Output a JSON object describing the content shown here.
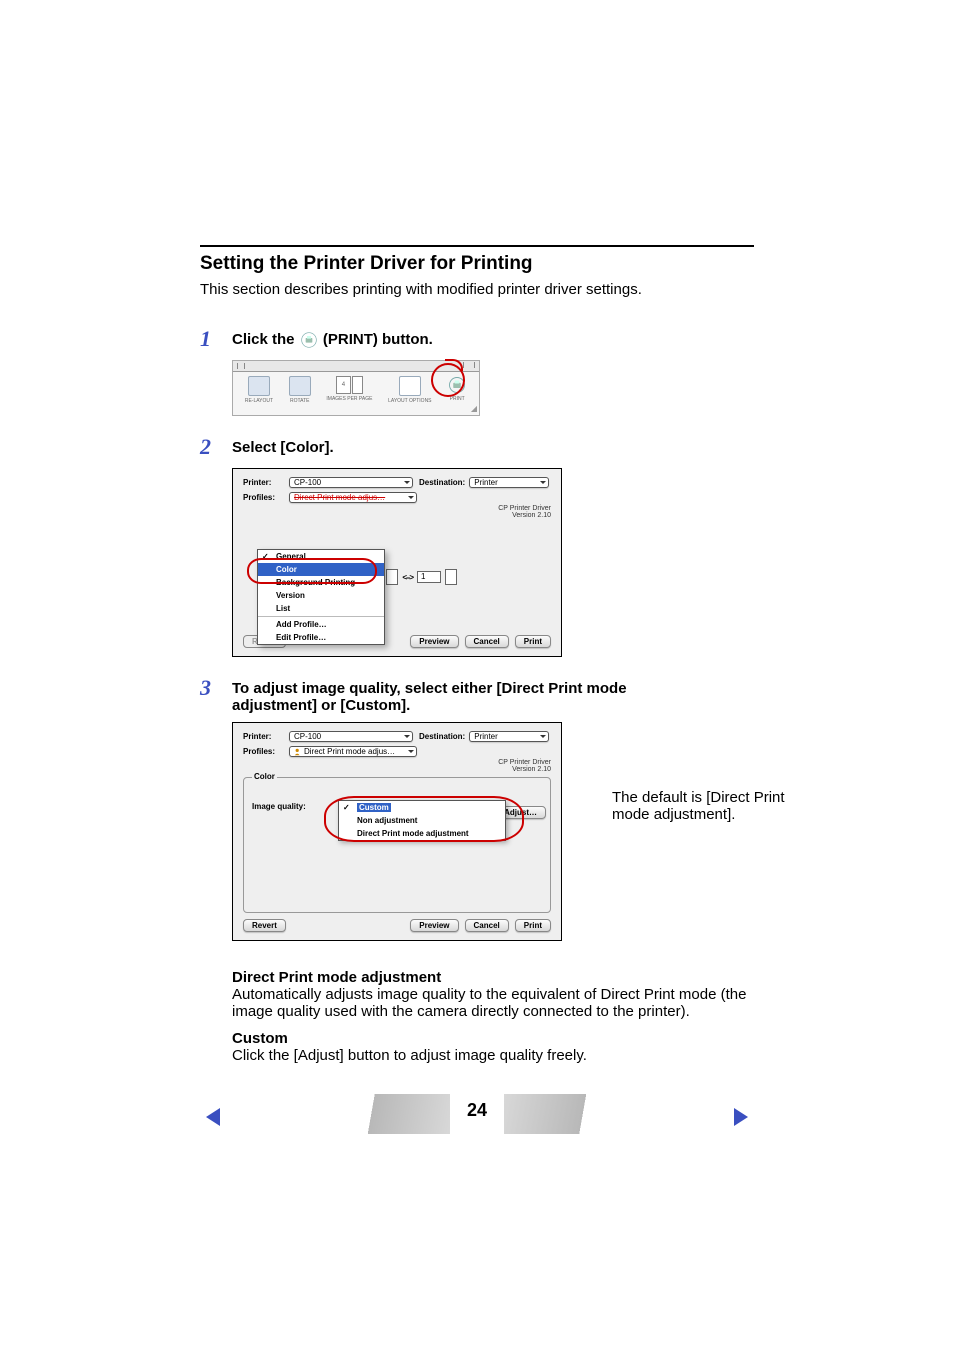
{
  "section": {
    "title": "Setting the Printer Driver for Printing",
    "desc": "This section describes printing with modified printer driver settings."
  },
  "step1": {
    "num": "1",
    "text_before": "Click the ",
    "text_after": " (PRINT) button.",
    "toolbar": {
      "relayout": "RE-LAYOUT",
      "rotate": "ROTATE",
      "images_per_page": "IMAGES PER PAGE",
      "images_value": "4",
      "layout_options": "LAYOUT OPTIONS",
      "print": "PRINT"
    }
  },
  "step2": {
    "num": "2",
    "text": "Select [Color].",
    "dialog": {
      "printer_label": "Printer:",
      "printer_value": "CP-100",
      "destination_label": "Destination:",
      "destination_value": "Printer",
      "profiles_label": "Profiles:",
      "profiles_value": "Direct Print mode adjus…",
      "driver_line1": "CP Printer Driver",
      "driver_line2": "Version 2.10",
      "copies_value": "1",
      "menu": {
        "general": "General",
        "color": "Color",
        "bgprint": "Background Printing",
        "version": "Version",
        "list": "List",
        "add": "Add Profile…",
        "edit": "Edit Profile…"
      },
      "buttons": {
        "revert": "Revert",
        "preview": "Preview",
        "cancel": "Cancel",
        "print": "Print"
      }
    }
  },
  "step3": {
    "num": "3",
    "text": "To adjust image quality, select either [Direct Print mode adjustment] or [Custom].",
    "dialog": {
      "printer_label": "Printer:",
      "printer_value": "CP-100",
      "destination_label": "Destination:",
      "destination_value": "Printer",
      "profiles_label": "Profiles:",
      "profiles_value": "Direct Print mode adjus…",
      "driver_line1": "CP Printer Driver",
      "driver_line2": "Version 2.10",
      "fieldset_label": "Color",
      "image_quality_label": "Image quality:",
      "iq_selected": "Custom",
      "iq_options": {
        "custom": "Custom",
        "non": "Non adjustment",
        "dpa": "Direct Print mode adjustment"
      },
      "adjust_btn": "Adjust…",
      "buttons": {
        "revert": "Revert",
        "preview": "Preview",
        "cancel": "Cancel",
        "print": "Print"
      }
    },
    "annotation": "The default is [Direct Print mode adjustment]."
  },
  "para1": {
    "head": "Direct Print mode adjustment",
    "body": "Automatically adjusts image quality to the equivalent of Direct Print mode (the image quality used with the camera directly connected to the printer)."
  },
  "para2": {
    "head": "Custom",
    "body": "Click the [Adjust] button to adjust image quality freely."
  },
  "footer": {
    "page": "24"
  }
}
